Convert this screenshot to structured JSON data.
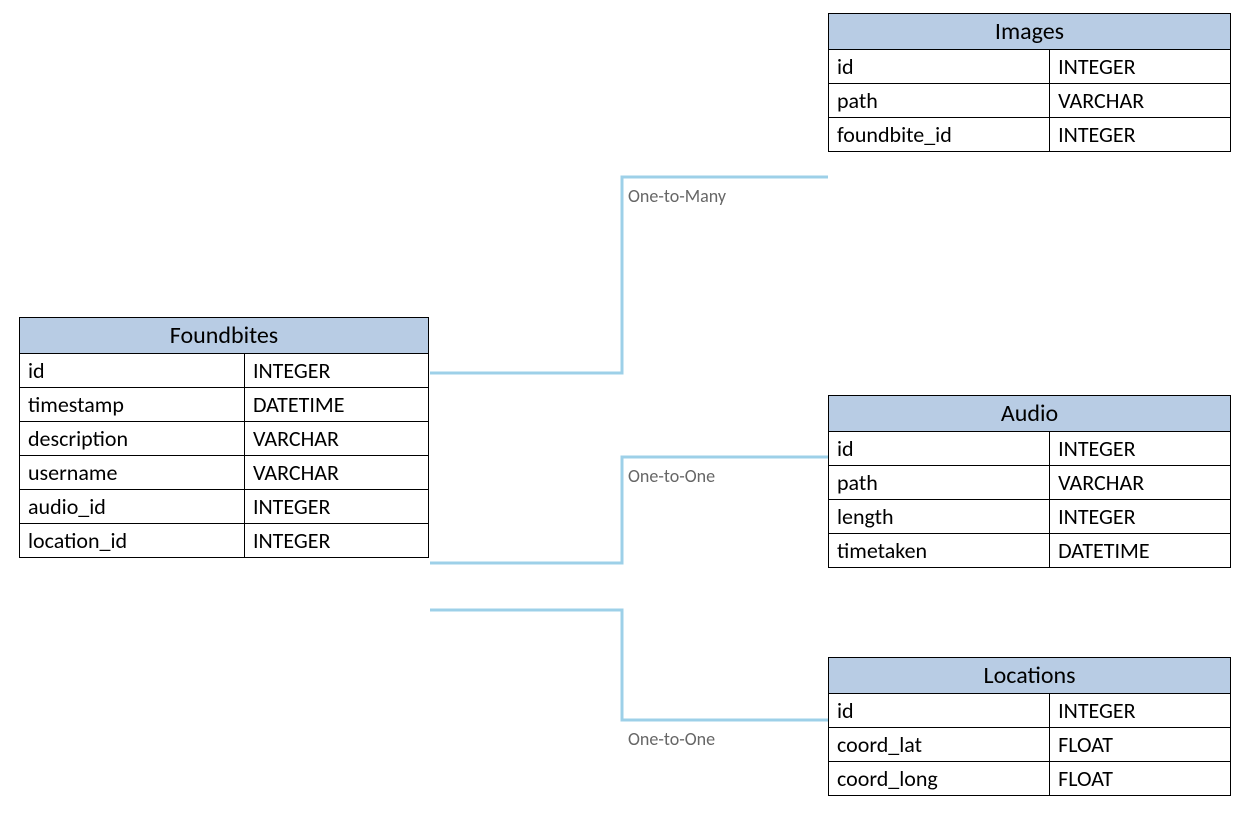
{
  "tables": {
    "foundbites": {
      "title": "Foundbites",
      "columns": [
        {
          "name": "id",
          "type": "INTEGER"
        },
        {
          "name": "timestamp",
          "type": "DATETIME"
        },
        {
          "name": "description",
          "type": "VARCHAR"
        },
        {
          "name": "username",
          "type": "VARCHAR"
        },
        {
          "name": "audio_id",
          "type": "INTEGER"
        },
        {
          "name": "location_id",
          "type": "INTEGER"
        }
      ]
    },
    "images": {
      "title": "Images",
      "columns": [
        {
          "name": "id",
          "type": "INTEGER"
        },
        {
          "name": "path",
          "type": "VARCHAR"
        },
        {
          "name": "foundbite_id",
          "type": "INTEGER"
        }
      ]
    },
    "audio": {
      "title": "Audio",
      "columns": [
        {
          "name": "id",
          "type": "INTEGER"
        },
        {
          "name": "path",
          "type": "VARCHAR"
        },
        {
          "name": "length",
          "type": "INTEGER"
        },
        {
          "name": "timetaken",
          "type": "DATETIME"
        }
      ]
    },
    "locations": {
      "title": "Locations",
      "columns": [
        {
          "name": "id",
          "type": "INTEGER"
        },
        {
          "name": "coord_lat",
          "type": "FLOAT"
        },
        {
          "name": "coord_long",
          "type": "FLOAT"
        }
      ]
    }
  },
  "relations": {
    "foundbites_images": "One-to-Many",
    "foundbites_audio": "One-to-One",
    "foundbites_locations": "One-to-One"
  }
}
